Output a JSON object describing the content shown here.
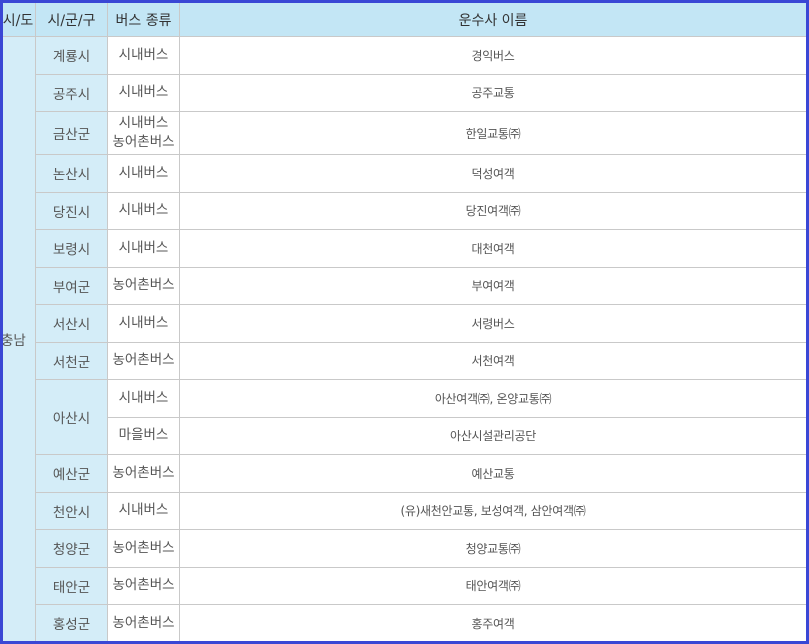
{
  "table": {
    "headers": [
      "시/도",
      "시/군/구",
      "버스 종류",
      "운수사 이름"
    ],
    "sido": "충남",
    "rows": [
      {
        "sigungu": "계룡시",
        "bus_type": [
          "시내버스"
        ],
        "operators": "경익버스"
      },
      {
        "sigungu": "공주시",
        "bus_type": [
          "시내버스"
        ],
        "operators": "공주교통"
      },
      {
        "sigungu": "금산군",
        "bus_type": [
          "시내버스",
          "농어촌버스"
        ],
        "operators": "한일교통㈜"
      },
      {
        "sigungu": "논산시",
        "bus_type": [
          "시내버스"
        ],
        "operators": "덕성여객"
      },
      {
        "sigungu": "당진시",
        "bus_type": [
          "시내버스"
        ],
        "operators": "당진여객㈜"
      },
      {
        "sigungu": "보령시",
        "bus_type": [
          "시내버스"
        ],
        "operators": "대천여객"
      },
      {
        "sigungu": "부여군",
        "bus_type": [
          "농어촌버스"
        ],
        "operators": "부여여객"
      },
      {
        "sigungu": "서산시",
        "bus_type": [
          "시내버스"
        ],
        "operators": "서령버스"
      },
      {
        "sigungu": "서천군",
        "bus_type": [
          "농어촌버스"
        ],
        "operators": "서천여객"
      },
      {
        "sigungu": "아산시",
        "bus_type": [
          "시내버스"
        ],
        "operators": "아산여객㈜, 온양교통㈜"
      },
      {
        "sigungu": "",
        "bus_type": [
          "마을버스"
        ],
        "operators": "아산시설관리공단"
      },
      {
        "sigungu": "예산군",
        "bus_type": [
          "농어촌버스"
        ],
        "operators": "예산교통"
      },
      {
        "sigungu": "천안시",
        "bus_type": [
          "시내버스"
        ],
        "operators": "(유)새천안교통, 보성여객, 삼안여객㈜"
      },
      {
        "sigungu": "청양군",
        "bus_type": [
          "농어촌버스"
        ],
        "operators": "청양교통㈜"
      },
      {
        "sigungu": "태안군",
        "bus_type": [
          "농어촌버스"
        ],
        "operators": "태안여객㈜"
      },
      {
        "sigungu": "홍성군",
        "bus_type": [
          "농어촌버스"
        ],
        "operators": "홍주여객"
      }
    ]
  },
  "colors": {
    "border": "#3a47d5",
    "header_bg": "#c3e6f5",
    "region_bg": "#d4edf8",
    "grid": "#c9c9c9"
  }
}
